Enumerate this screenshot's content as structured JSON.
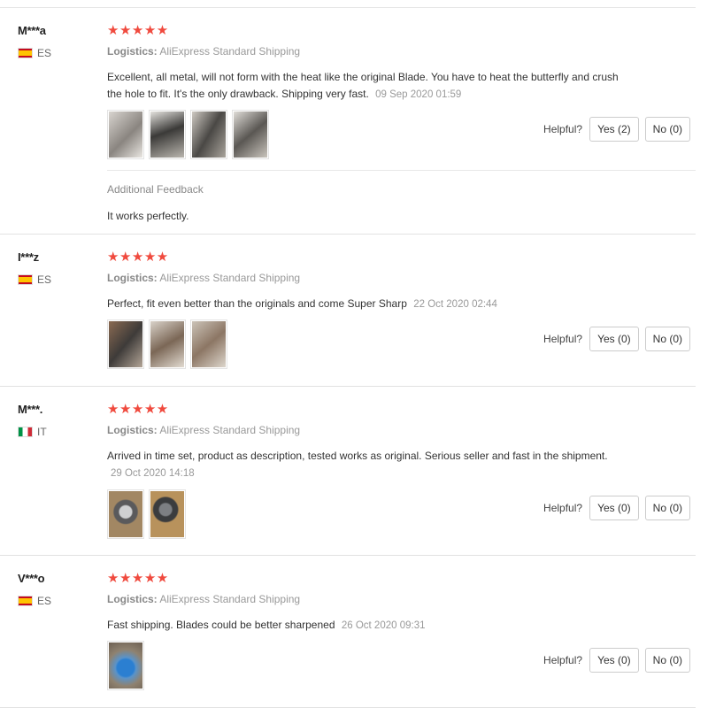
{
  "reviews": [
    {
      "user": "M***a",
      "country": "ES",
      "stars": "★★★★★",
      "logistics_label": "Logistics:",
      "logistics_value": "AliExpress Standard Shipping",
      "text": "Excellent, all metal, will not form with the heat like the original Blade. You have to heat the butterfly and crush the hole to fit. It's the only drawback. Shipping very fast.",
      "date": "09 Sep 2020 01:59",
      "photos": [
        "review photo",
        "review photo",
        "review photo",
        "review photo"
      ],
      "helpful_label": "Helpful?",
      "yes_label": "Yes (2)",
      "no_label": "No (0)",
      "additional_feedback_title": "Additional Feedback",
      "additional_feedback_text": "It works perfectly."
    },
    {
      "user": "I***z",
      "country": "ES",
      "stars": "★★★★★",
      "logistics_label": "Logistics:",
      "logistics_value": "AliExpress Standard Shipping",
      "text": "Perfect, fit even better than the originals and come Super Sharp",
      "date": "22 Oct 2020 02:44",
      "photos": [
        "review photo",
        "review photo",
        "review photo"
      ],
      "helpful_label": "Helpful?",
      "yes_label": "Yes (0)",
      "no_label": "No (0)"
    },
    {
      "user": "M***.",
      "country": "IT",
      "stars": "★★★★★",
      "logistics_label": "Logistics:",
      "logistics_value": "AliExpress Standard Shipping",
      "text": "Arrived in time set, product as description, tested works as original. Serious seller and fast in the shipment.",
      "date": "29 Oct 2020 14:18",
      "photos": [
        "review photo",
        "review photo"
      ],
      "helpful_label": "Helpful?",
      "yes_label": "Yes (0)",
      "no_label": "No (0)"
    },
    {
      "user": "V***o",
      "country": "ES",
      "stars": "★★★★★",
      "logistics_label": "Logistics:",
      "logistics_value": "AliExpress Standard Shipping",
      "text": "Fast shipping. Blades could be better sharpened",
      "date": "26 Oct 2020 09:31",
      "photos": [
        "review photo"
      ],
      "helpful_label": "Helpful?",
      "yes_label": "Yes (0)",
      "no_label": "No (0)"
    }
  ],
  "colors": {
    "star": "#f04a3e",
    "muted": "#999999",
    "border": "#e2e2e2"
  }
}
